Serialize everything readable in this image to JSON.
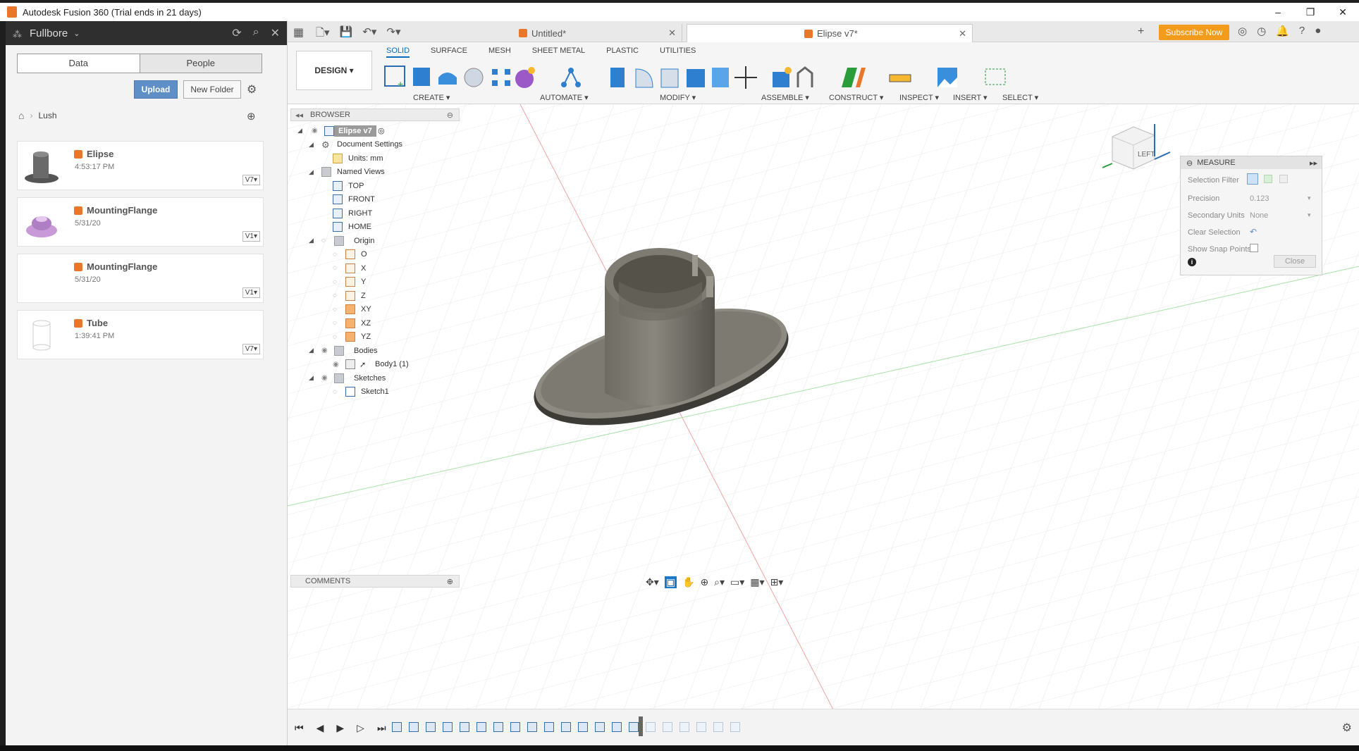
{
  "window": {
    "title": "Autodesk Fusion 360 (Trial ends in 21 days)",
    "controls": [
      "–",
      "❐",
      "✕"
    ]
  },
  "datapanel": {
    "team": "Fullbore",
    "tabs": {
      "data": "Data",
      "people": "People"
    },
    "upload": "Upload",
    "new_folder": "New Folder",
    "breadcrumb": "Lush",
    "files": [
      {
        "name": "Elipse",
        "date": "4:53:17 PM",
        "version": "V7▾"
      },
      {
        "name": "MountingFlange",
        "date": "5/31/20",
        "version": "V1▾"
      },
      {
        "name": "MountingFlange",
        "date": "5/31/20",
        "version": "V1▾"
      },
      {
        "name": "Tube",
        "date": "1:39:41 PM",
        "version": "V7▾"
      }
    ]
  },
  "tabs": {
    "untitled": "Untitled*",
    "active": "Elipse v7*",
    "subscribe": "Subscribe Now"
  },
  "ribbon": {
    "design": "DESIGN ▾",
    "tabs": [
      "SOLID",
      "SURFACE",
      "MESH",
      "SHEET METAL",
      "PLASTIC",
      "UTILITIES"
    ],
    "groups": {
      "create": "CREATE ▾",
      "automate": "AUTOMATE ▾",
      "modify": "MODIFY ▾",
      "assemble": "ASSEMBLE ▾",
      "construct": "CONSTRUCT ▾",
      "inspect": "INSPECT ▾",
      "insert": "INSERT ▾",
      "select": "SELECT ▾"
    }
  },
  "browser": {
    "title": "BROWSER",
    "root": "Elipse v7",
    "document_settings": "Document Settings",
    "units": "Units: mm",
    "named_views": "Named Views",
    "views": [
      "TOP",
      "FRONT",
      "RIGHT",
      "HOME"
    ],
    "origin": "Origin",
    "origin_items": [
      "O",
      "X",
      "Y",
      "Z",
      "XY",
      "XZ",
      "YZ"
    ],
    "bodies": "Bodies",
    "body1": "Body1 (1)",
    "sketches": "Sketches",
    "sketch1": "Sketch1"
  },
  "measure": {
    "title": "MEASURE",
    "selection_filter": "Selection Filter",
    "precision": "Precision",
    "precision_value": "0.123",
    "secondary_units": "Secondary Units",
    "secondary_units_value": "None",
    "clear_selection": "Clear Selection",
    "show_snap_points": "Show Snap Points",
    "close": "Close"
  },
  "comments": {
    "title": "COMMENTS"
  },
  "viewcube": {
    "face": "LEFT"
  }
}
